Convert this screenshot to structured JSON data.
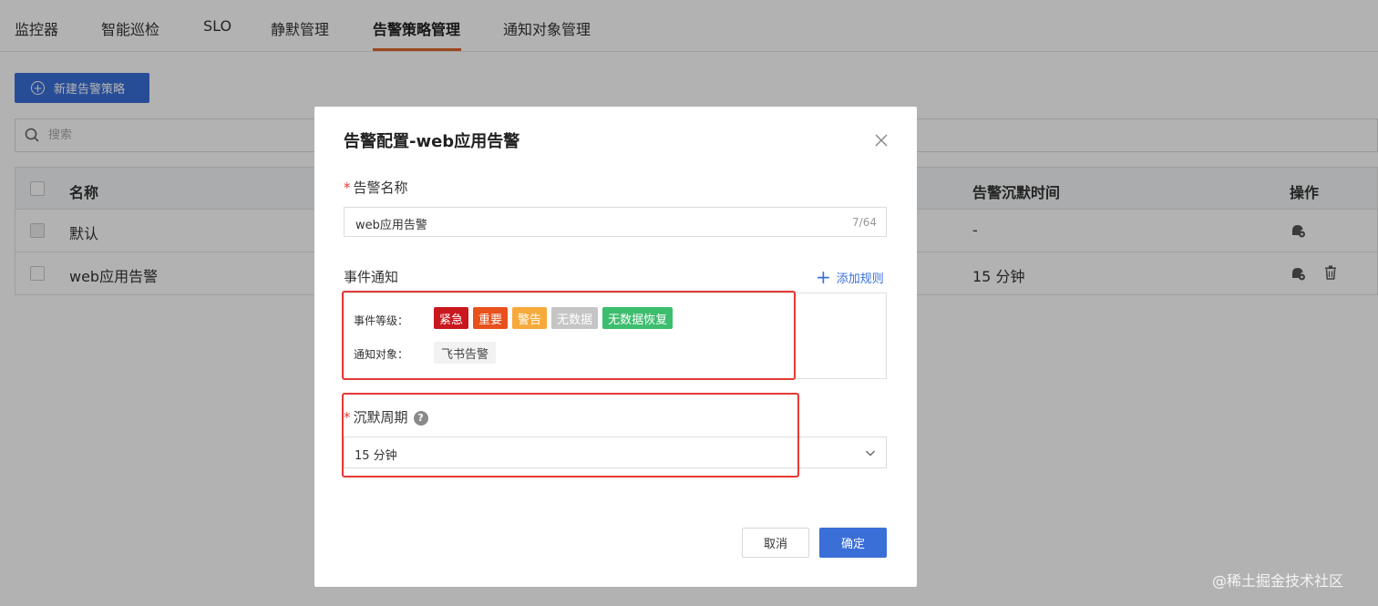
{
  "tabs": [
    "监控器",
    "智能巡检",
    "SLO",
    "静默管理",
    "告警策略管理",
    "通知对象管理"
  ],
  "toolbar": {
    "new_label": "新建告警策略"
  },
  "search": {
    "placeholder": "搜索"
  },
  "table": {
    "headers": {
      "name": "名称",
      "silence": "告警沉默时间",
      "ops": "操作"
    },
    "rows": [
      {
        "name": "默认",
        "silence": "-"
      },
      {
        "name": "web应用告警",
        "silence": "15 分钟"
      }
    ]
  },
  "modal": {
    "title": "告警配置-web应用告警",
    "name_label": "告警名称",
    "name_value": "web应用告警",
    "name_count": "7/64",
    "event_label": "事件通知",
    "add_rule": "添加规则",
    "level_label": "事件等级：",
    "levels": [
      {
        "label": "紧急",
        "color": "#c9171e"
      },
      {
        "label": "重要",
        "color": "#e8501c"
      },
      {
        "label": "警告",
        "color": "#f7a93b"
      },
      {
        "label": "无数据",
        "color": "#c5c5c5"
      },
      {
        "label": "无数据恢复",
        "color": "#3dbd6e"
      }
    ],
    "target_label": "通知对象：",
    "target_value": "飞书告警",
    "silence_label": "沉默周期",
    "silence_value": "15 分钟",
    "cancel": "取消",
    "ok": "确定"
  },
  "colors": {
    "primary": "#3a6fd8",
    "active_tab": "#e0662a",
    "highlight": "#e53935"
  },
  "watermark": "@稀土掘金技术社区"
}
